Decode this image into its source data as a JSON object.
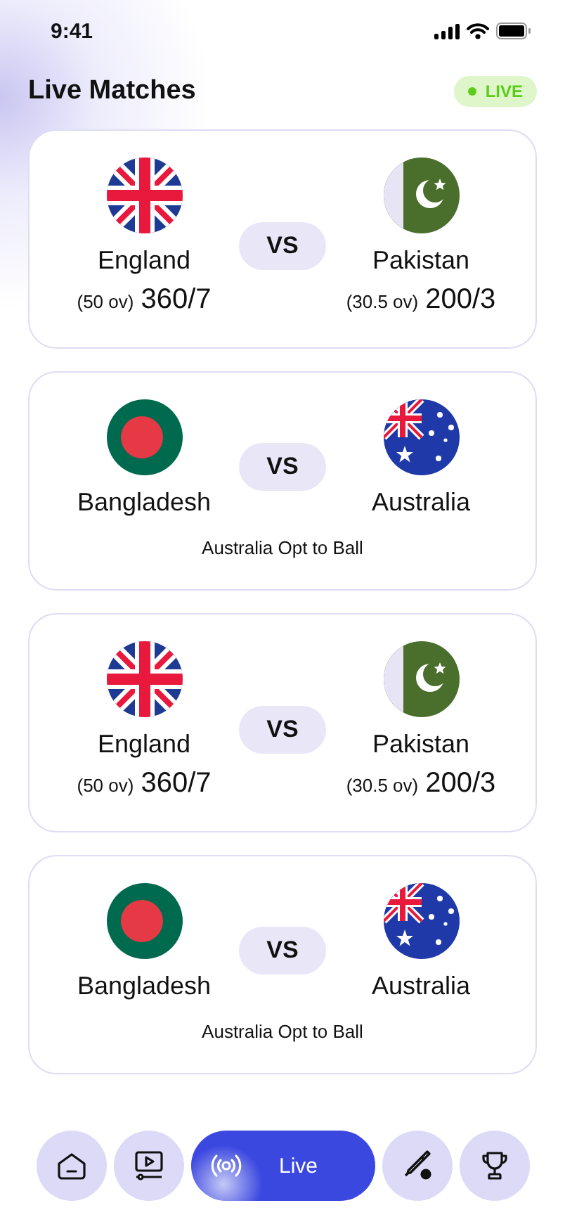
{
  "status_bar": {
    "time": "9:41"
  },
  "header": {
    "title": "Live Matches",
    "badge": {
      "label": "LIVE",
      "color": "#5ccd1a"
    }
  },
  "matches": [
    {
      "teams": [
        {
          "name": "England",
          "kind": "uk",
          "overs": "(50 ov)",
          "score": "360/7"
        },
        {
          "name": "Pakistan",
          "kind": "pakistan",
          "overs": "(30.5 ov)",
          "score": "200/3"
        }
      ],
      "vs": "VS"
    },
    {
      "teams": [
        {
          "name": "Bangladesh",
          "kind": "bangladesh"
        },
        {
          "name": "Australia",
          "kind": "australia"
        }
      ],
      "vs": "VS",
      "note": "Australia Opt to Ball"
    },
    {
      "teams": [
        {
          "name": "England",
          "kind": "uk",
          "overs": "(50 ov)",
          "score": "360/7"
        },
        {
          "name": "Pakistan",
          "kind": "pakistan",
          "overs": "(30.5 ov)",
          "score": "200/3"
        }
      ],
      "vs": "VS"
    },
    {
      "teams": [
        {
          "name": "Bangladesh",
          "kind": "bangladesh"
        },
        {
          "name": "Australia",
          "kind": "australia"
        }
      ],
      "vs": "VS",
      "note": "Australia Opt to Ball"
    }
  ],
  "nav": [
    {
      "kind": "home",
      "selected": false
    },
    {
      "kind": "video",
      "selected": false
    },
    {
      "kind": "live",
      "label": "Live",
      "selected": true
    },
    {
      "kind": "cricket",
      "selected": false
    },
    {
      "kind": "trophy",
      "selected": false
    }
  ]
}
